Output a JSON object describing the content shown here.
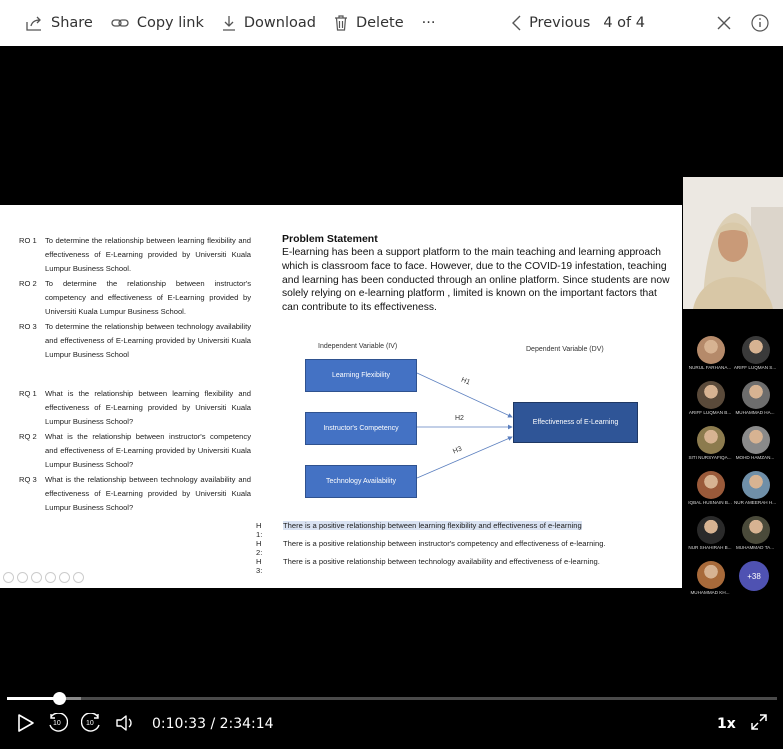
{
  "toolbar": {
    "share": "Share",
    "copy_link": "Copy link",
    "download": "Download",
    "delete": "Delete",
    "more": "···",
    "previous": "Previous",
    "counter": "4 of 4"
  },
  "slide": {
    "research_objectives": [
      {
        "code": "RO 1",
        "text": "To determine the relationship between learning flexibility and effectiveness of E-Learning provided by Universiti Kuala Lumpur Business School."
      },
      {
        "code": "RO 2",
        "text": "To determine the relationship between instructor's competency and effectiveness of E-Learning provided by Universiti Kuala Lumpur Business School."
      },
      {
        "code": "RO 3",
        "text": "To determine the relationship between technology availability and effectiveness of E-Learning provided by Universiti Kuala Lumpur Business School"
      }
    ],
    "research_questions": [
      {
        "code": "RQ 1",
        "text": "What is the relationship between learning flexibility and effectiveness of E-Learning provided by Universiti Kuala Lumpur Business School?"
      },
      {
        "code": "RQ 2",
        "text": "What is the relationship between instructor's competency and effectiveness of E-Learning provided by Universiti Kuala Lumpur Business School?"
      },
      {
        "code": "RQ 3",
        "text": "What is the relationship between technology availability and effectiveness of E-Learning provided by Universiti Kuala Lumpur Business School?"
      }
    ],
    "problem_title": "Problem Statement",
    "problem_body": "E-learning has been a support platform to the main teaching and learning approach which is classroom face to face. However, due to the COVID-19 infestation, teaching and learning has been conducted through an online platform.  Since students are now solely relying on e-learning platform , limited is known on the important factors that can contribute to its effectiveness.",
    "diagram": {
      "iv_label": "Independent Variable (IV)",
      "dv_label": "Dependent Variable (DV)",
      "iv_boxes": [
        "Learning Flexibility",
        "Instructor's Competency",
        "Technology Availability"
      ],
      "dv_box": "Effectiveness of E-Learning",
      "arrows": [
        "H1",
        "H2",
        "H3"
      ]
    },
    "hypotheses": [
      {
        "code": "H 1:",
        "text": "There is a positive relationship between learning flexibility and  effectiveness of e-learning"
      },
      {
        "code": "H 2:",
        "text": "There is a positive relationship between instructor's competency and  effectiveness of e-learning."
      },
      {
        "code": "H 3:",
        "text": "There is a positive relationship between technology availability and  effectiveness of e-learning."
      }
    ]
  },
  "participants": [
    {
      "name": "NURUL FARHANA...",
      "color": "#b58a6a"
    },
    {
      "name": "ARIFF LUQMAN S...",
      "color": "#3a3a3a"
    },
    {
      "name": "ARIFF LUQMAN B...",
      "color": "#5a4a3a"
    },
    {
      "name": "MUHAMMAD HA...",
      "color": "#6d6d6d"
    },
    {
      "name": "SITI NURSYAFIQA...",
      "color": "#8c7b4e"
    },
    {
      "name": "MOHD HAMZAN...",
      "color": "#8a8a8a"
    },
    {
      "name": "IQBAL HUSNAIN B...",
      "color": "#9a5a3a"
    },
    {
      "name": "NUR AMEERAH H...",
      "color": "#6f8fa8"
    },
    {
      "name": "NUR SHAHIRAH B...",
      "color": "#2a2a2a"
    },
    {
      "name": "MUHAMMAD TA...",
      "color": "#4a4a3a"
    },
    {
      "name": "MUHAMMAD KH...",
      "color": "#a86a3a"
    }
  ],
  "more_participants": "+38",
  "player": {
    "progress_fraction": 0.068,
    "current_time": "0:10:33",
    "separator": "/",
    "duration": "2:34:14",
    "speed": "1x",
    "skip_back": "10",
    "skip_forward": "10"
  }
}
